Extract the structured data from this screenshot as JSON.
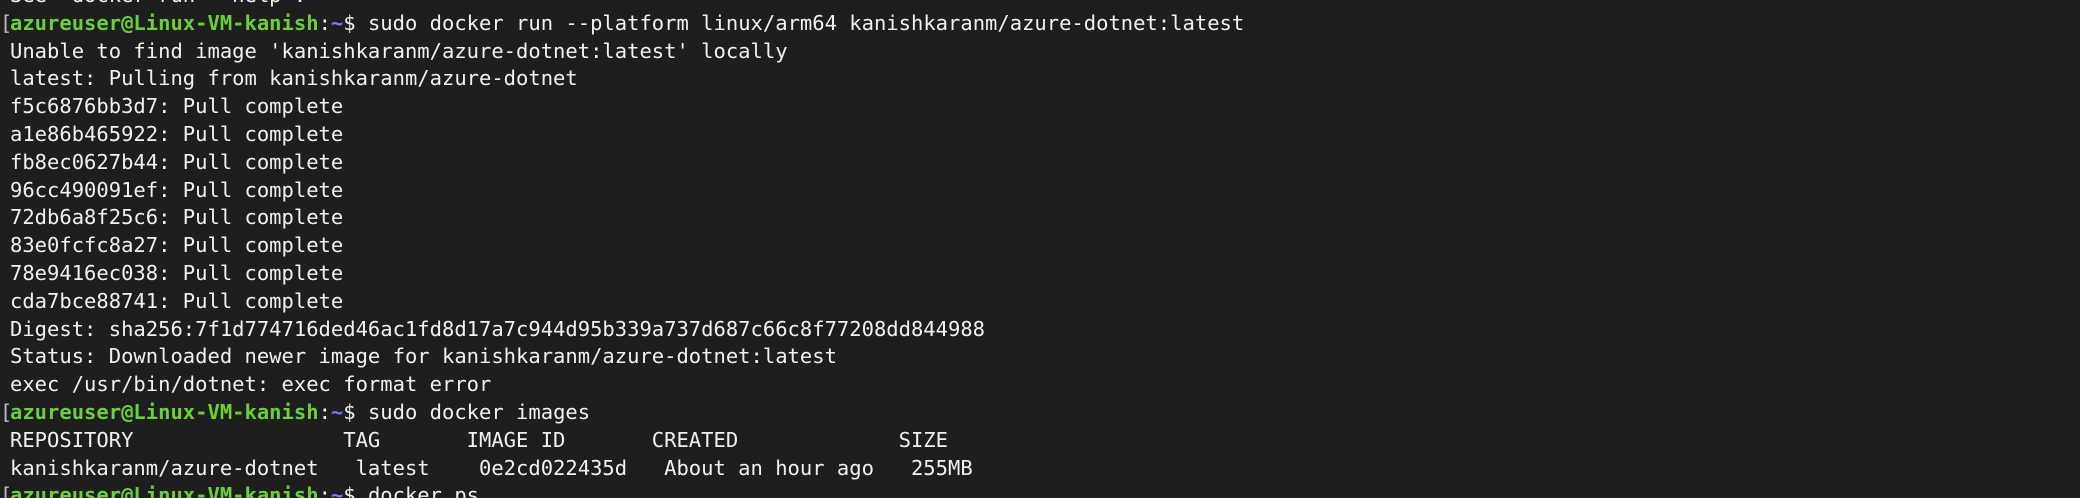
{
  "terminal": {
    "prompt_user": "azureuser@Linux-VM-kanish",
    "prompt_colon": ":",
    "prompt_path": "~",
    "prompt_symbol": "$ ",
    "lines": [
      {
        "type": "output",
        "text": "See 'docker run --help'."
      },
      {
        "type": "prompt",
        "command": "sudo docker run --platform linux/arm64 kanishkaranm/azure-dotnet:latest"
      },
      {
        "type": "output",
        "text": "Unable to find image 'kanishkaranm/azure-dotnet:latest' locally"
      },
      {
        "type": "output",
        "text": "latest: Pulling from kanishkaranm/azure-dotnet"
      },
      {
        "type": "output",
        "text": "f5c6876bb3d7: Pull complete"
      },
      {
        "type": "output",
        "text": "a1e86b465922: Pull complete"
      },
      {
        "type": "output",
        "text": "fb8ec0627b44: Pull complete"
      },
      {
        "type": "output",
        "text": "96cc490091ef: Pull complete"
      },
      {
        "type": "output",
        "text": "72db6a8f25c6: Pull complete"
      },
      {
        "type": "output",
        "text": "83e0fcfc8a27: Pull complete"
      },
      {
        "type": "output",
        "text": "78e9416ec038: Pull complete"
      },
      {
        "type": "output",
        "text": "cda7bce88741: Pull complete"
      },
      {
        "type": "output",
        "text": "Digest: sha256:7f1d774716ded46ac1fd8d17a7c944d95b339a737d687c66c8f77208dd844988"
      },
      {
        "type": "output",
        "text": "Status: Downloaded newer image for kanishkaranm/azure-dotnet:latest"
      },
      {
        "type": "output",
        "text": "exec /usr/bin/dotnet: exec format error"
      },
      {
        "type": "prompt",
        "command": "sudo docker images"
      },
      {
        "type": "output",
        "text": "REPOSITORY                 TAG       IMAGE ID       CREATED             SIZE"
      },
      {
        "type": "output",
        "text": "kanishkaranm/azure-dotnet   latest    0e2cd022435d   About an hour ago   255MB"
      },
      {
        "type": "prompt",
        "command": "docker ps"
      }
    ]
  },
  "colors": {
    "background": "#1e1e1e",
    "text": "#f1f1f1",
    "prompt_user": "#69d136",
    "prompt_path": "#6f7dff"
  }
}
